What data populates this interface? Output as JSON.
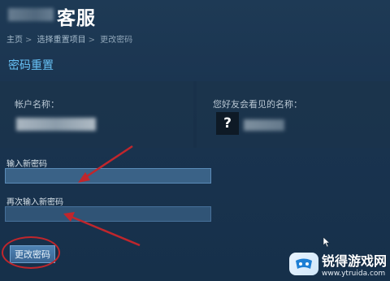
{
  "header": {
    "title": "客服"
  },
  "breadcrumb": {
    "home": "主页",
    "sep": ">",
    "choose": "选择重置项目",
    "current": "更改密码"
  },
  "section": {
    "title": "密码重置"
  },
  "account": {
    "account_label": "帐户名称：",
    "visible_label": "您好友会看见的名称：",
    "avatar_placeholder": "?"
  },
  "form": {
    "new_password_label": "输入新密码",
    "new_password_value": "",
    "confirm_password_label": "再次输入新密码",
    "confirm_password_value": "",
    "submit_label": "更改密码"
  },
  "watermark": {
    "name": "锐得游戏网",
    "url": "www.ytruida.com"
  },
  "colors": {
    "accent": "#67c1f5",
    "annotation": "#c0262c",
    "button": "#3a6592"
  }
}
